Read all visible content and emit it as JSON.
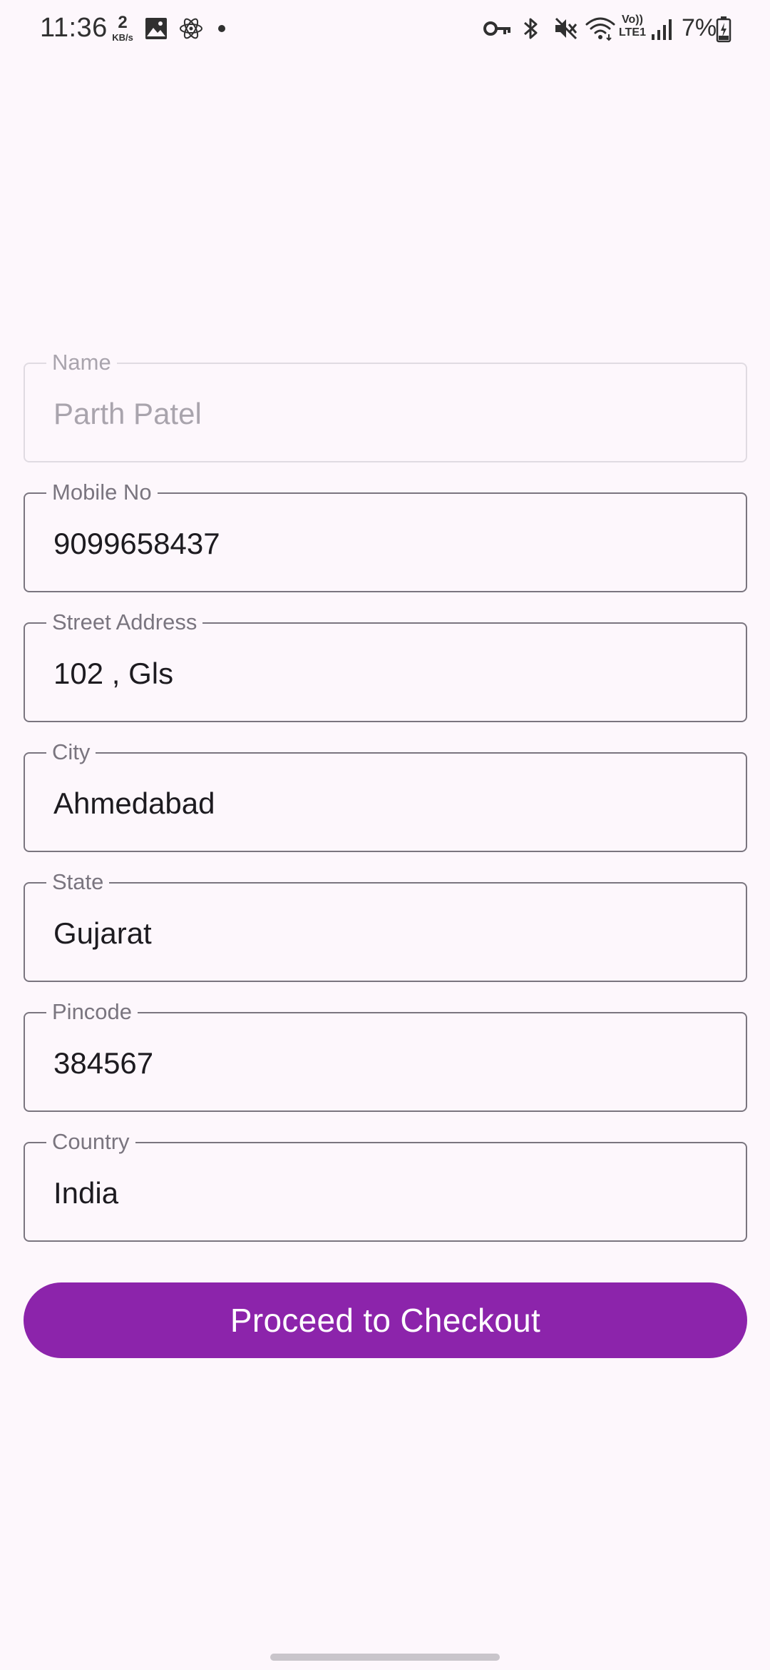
{
  "status_bar": {
    "time": "11:36",
    "net_speed_value": "2",
    "net_speed_unit": "KB/s",
    "battery_percent": "7%",
    "icons": [
      "gallery-icon",
      "atom-icon",
      "dot-icon",
      "vpn-key-icon",
      "bluetooth-icon",
      "mute-icon",
      "wifi-icon",
      "volte-icon",
      "signal-icon",
      "battery-charging-icon"
    ],
    "volte_label_top": "Vo))",
    "volte_label_bottom": "LTE1"
  },
  "form": {
    "name": {
      "label": "Name",
      "value": "Parth Patel",
      "enabled": false
    },
    "mobile": {
      "label": "Mobile No",
      "value": "9099658437"
    },
    "street": {
      "label": "Street Address",
      "value": "102 , Gls"
    },
    "city": {
      "label": "City",
      "value": "Ahmedabad"
    },
    "state": {
      "label": "State",
      "value": "Gujarat"
    },
    "pincode": {
      "label": "Pincode",
      "value": "384567"
    },
    "country": {
      "label": "Country",
      "value": "India"
    }
  },
  "checkout_button": {
    "label": "Proceed to Checkout"
  },
  "colors": {
    "background": "#fdf7fc",
    "accent": "#8c24ab",
    "outline": "#7a757f",
    "text": "#1d1b20"
  }
}
